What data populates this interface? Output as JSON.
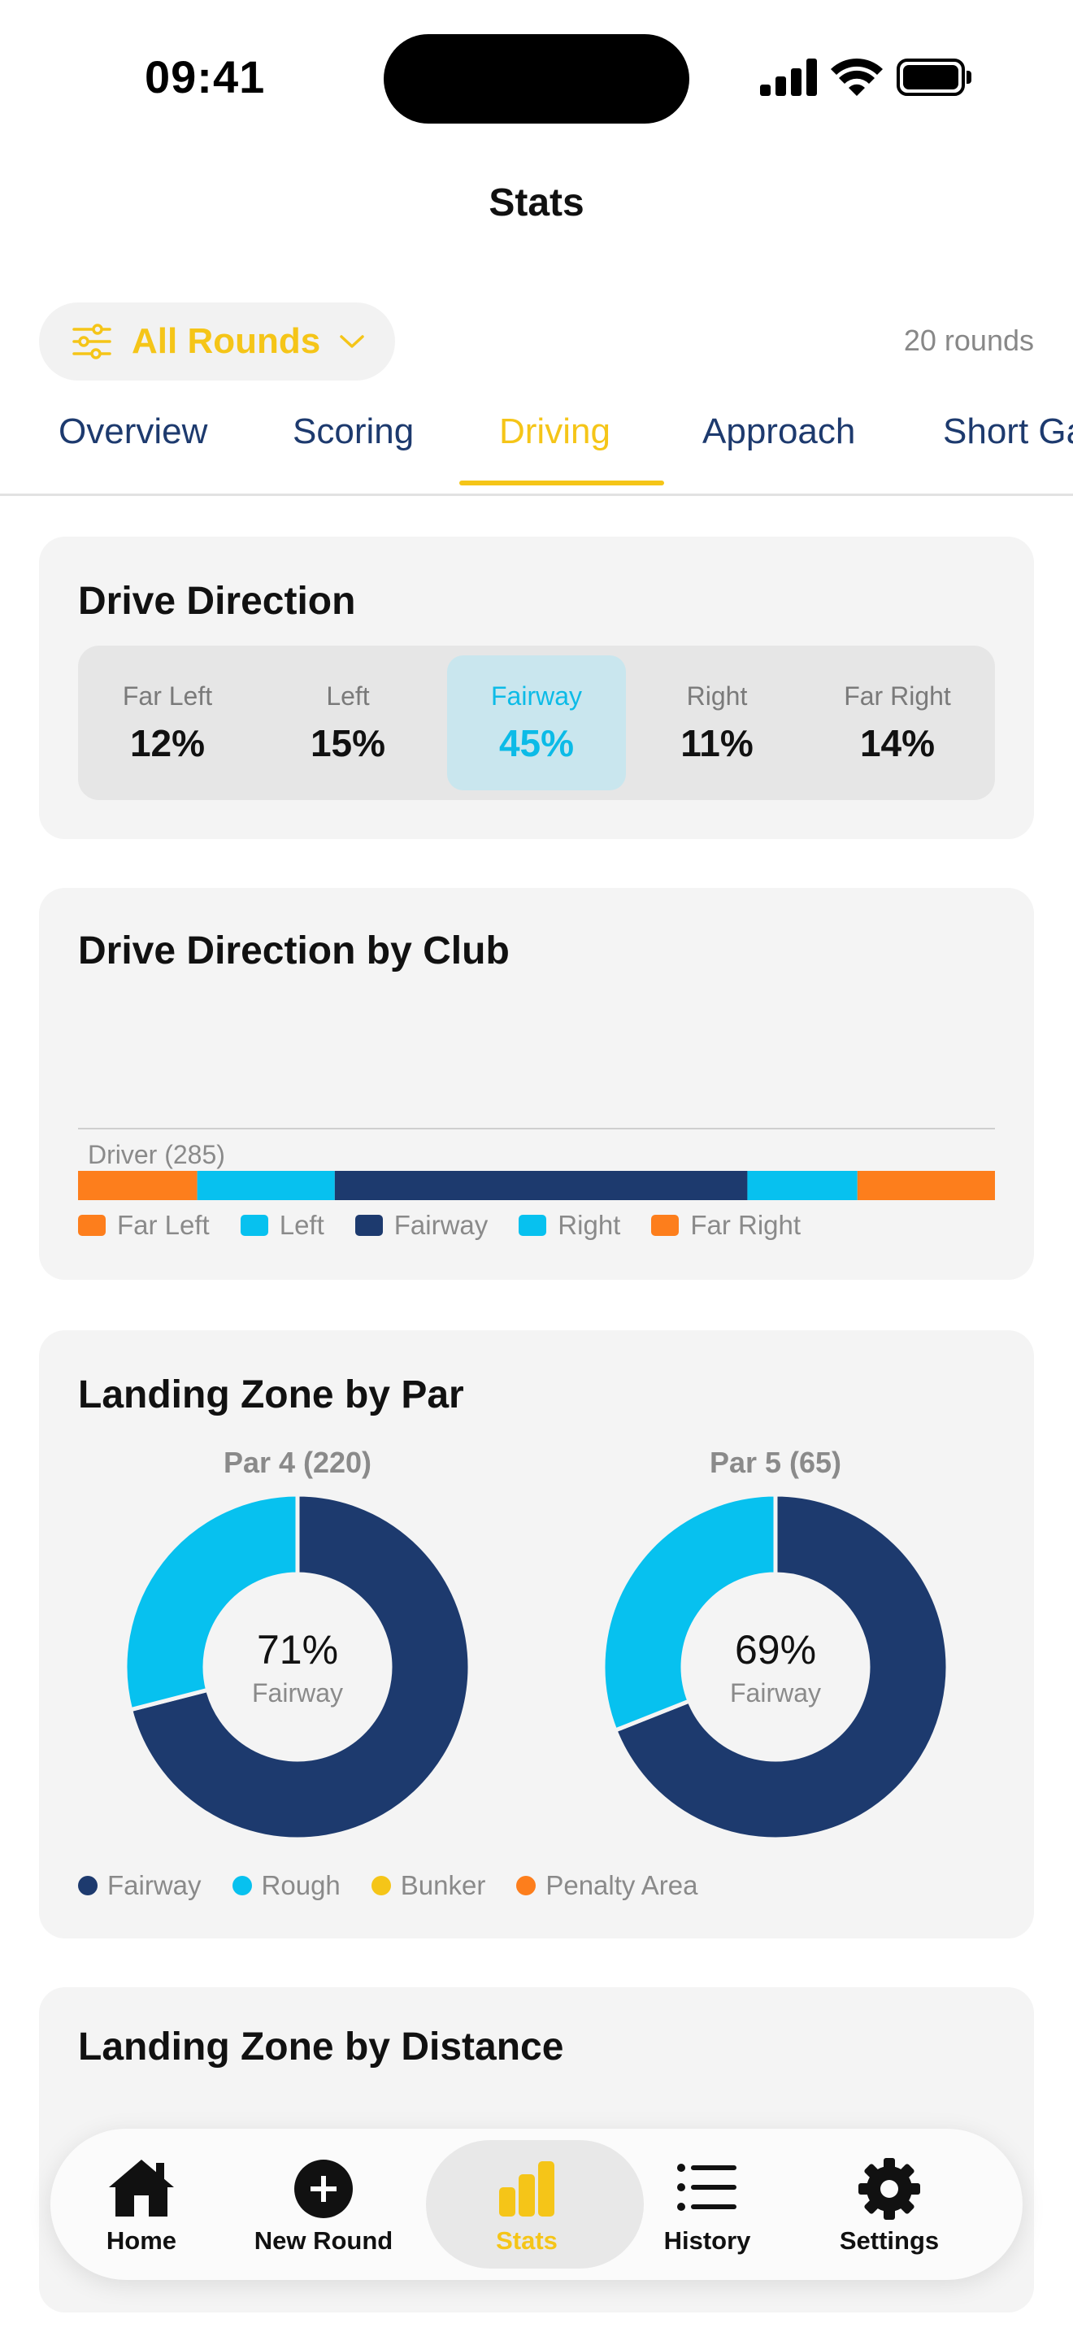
{
  "status_bar": {
    "time": "09:41"
  },
  "header": {
    "title": "Stats"
  },
  "filter": {
    "label": "All Rounds",
    "rounds_count": "20 rounds"
  },
  "tabs": [
    {
      "label": "Overview",
      "active": false
    },
    {
      "label": "Scoring",
      "active": false
    },
    {
      "label": "Driving",
      "active": true
    },
    {
      "label": "Approach",
      "active": false
    },
    {
      "label": "Short Game",
      "active": false
    }
  ],
  "drive_direction": {
    "title": "Drive Direction",
    "cells": [
      {
        "label": "Far Left",
        "value": "12%"
      },
      {
        "label": "Left",
        "value": "15%"
      },
      {
        "label": "Fairway",
        "value": "45%",
        "highlight": true
      },
      {
        "label": "Right",
        "value": "11%"
      },
      {
        "label": "Far Right",
        "value": "14%"
      }
    ]
  },
  "drive_by_club": {
    "title": "Drive Direction by Club",
    "chart_data": {
      "type": "bar",
      "orientation": "horizontal-stacked",
      "categories": [
        "Driver (285)"
      ],
      "series": [
        {
          "name": "Far Left",
          "values": [
            13
          ],
          "color": "#fd7e1c"
        },
        {
          "name": "Left",
          "values": [
            15
          ],
          "color": "#07c1ef"
        },
        {
          "name": "Fairway",
          "values": [
            45
          ],
          "color": "#1d3a6e"
        },
        {
          "name": "Right",
          "values": [
            12
          ],
          "color": "#07c1ef"
        },
        {
          "name": "Far Right",
          "values": [
            15
          ],
          "color": "#fd7e1c"
        }
      ],
      "legend": "bottom"
    }
  },
  "landing_zone_par": {
    "title": "Landing Zone by Par",
    "chart_data": [
      {
        "type": "pie",
        "title": "Par 4 (220)",
        "center_value": "71%",
        "center_label": "Fairway",
        "categories": [
          "Fairway",
          "Rough",
          "Bunker",
          "Penalty Area"
        ],
        "values": [
          71,
          29,
          0,
          0
        ],
        "colors": [
          "#1d3a6e",
          "#07c1ef",
          "#f5c518",
          "#fd7e1c"
        ]
      },
      {
        "type": "pie",
        "title": "Par 5 (65)",
        "center_value": "69%",
        "center_label": "Fairway",
        "categories": [
          "Fairway",
          "Rough",
          "Bunker",
          "Penalty Area"
        ],
        "values": [
          69,
          31,
          0,
          0
        ],
        "colors": [
          "#1d3a6e",
          "#07c1ef",
          "#f5c518",
          "#fd7e1c"
        ]
      }
    ],
    "legend": [
      {
        "label": "Fairway",
        "color": "#1d3a6e"
      },
      {
        "label": "Rough",
        "color": "#07c1ef"
      },
      {
        "label": "Bunker",
        "color": "#f5c518"
      },
      {
        "label": "Penalty Area",
        "color": "#fd7e1c"
      }
    ]
  },
  "landing_zone_distance": {
    "title": "Landing Zone by Distance"
  },
  "nav": [
    {
      "label": "Home",
      "icon": "home-icon"
    },
    {
      "label": "New Round",
      "icon": "plus-circle-icon"
    },
    {
      "label": "Stats",
      "icon": "bar-chart-icon",
      "active": true
    },
    {
      "label": "History",
      "icon": "list-icon"
    },
    {
      "label": "Settings",
      "icon": "gear-icon"
    }
  ],
  "colors": {
    "accent": "#f5c518",
    "navy": "#1d3a6e",
    "cyan": "#07c1ef",
    "orange": "#fd7e1c"
  }
}
